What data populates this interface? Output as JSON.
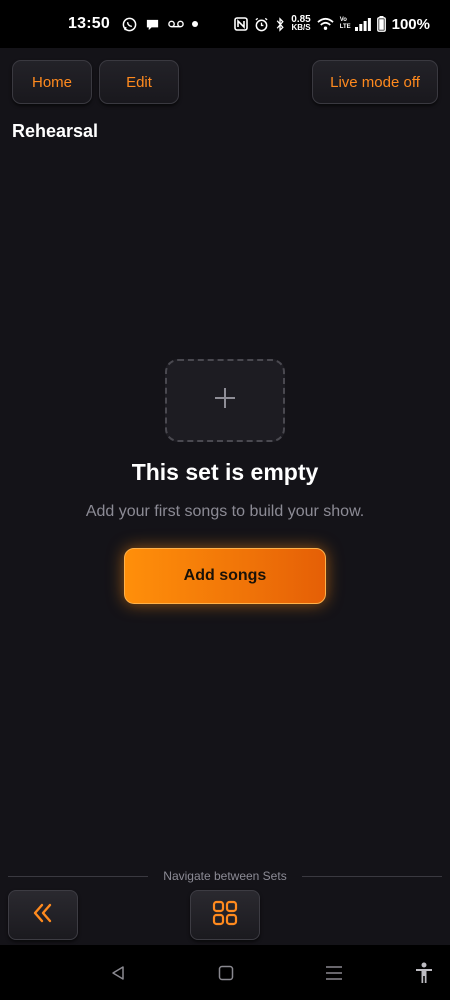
{
  "status_bar": {
    "time": "13:50",
    "net_speed_value": "0.85",
    "net_speed_unit": "KB/S",
    "volte_top": "Vo",
    "volte_bottom": "LTE",
    "battery": "100%"
  },
  "header": {
    "home_label": "Home",
    "edit_label": "Edit",
    "live_mode_label": "Live mode off"
  },
  "set": {
    "title": "Rehearsal"
  },
  "empty_state": {
    "title": "This set is empty",
    "subtitle": "Add your first songs to build your show.",
    "add_button_label": "Add songs"
  },
  "bottom_nav": {
    "caption": "Navigate between Sets"
  },
  "colors": {
    "accent": "#ff8a1e",
    "background": "#141318"
  },
  "icons": {
    "prev": "double-chevron-left-icon",
    "grid": "grid-icon",
    "add": "plus-icon"
  }
}
